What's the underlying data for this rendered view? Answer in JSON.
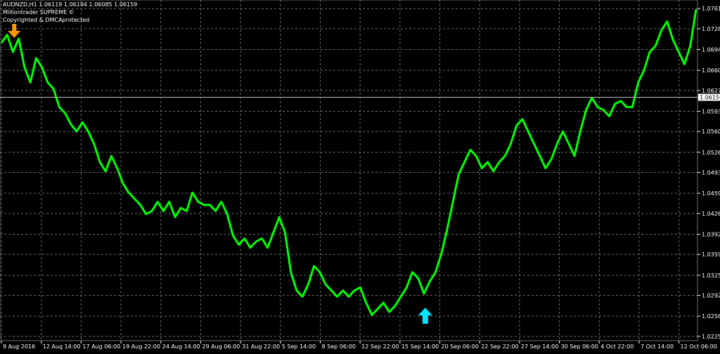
{
  "header": {
    "symbol_line": "AUDNZD,H1  1.06119 1.06194 1.06085 1.06159",
    "indicator_name": "Milliontrader SUPREME ©",
    "copyright": "Copyrighted & DMCAprotected"
  },
  "colors": {
    "background": "#000000",
    "price_line": "#00ff00",
    "grid": "#6e6e6e",
    "sell_arrow": "#ff9900",
    "buy_arrow": "#00e5ff",
    "axis_text": "#ffffff"
  },
  "chart_data": {
    "type": "line",
    "title": "AUDNZD,H1",
    "ylim": [
      1.0218,
      1.0775
    ],
    "current_price": "1.06159",
    "y_tick_labels": [
      "1.07610",
      "1.07280",
      "1.06940",
      "1.06600",
      "1.06270",
      "1.05930",
      "1.05600",
      "1.05260",
      "1.04930",
      "1.04590",
      "1.04260",
      "1.03920",
      "1.03590",
      "1.03250",
      "1.02920",
      "1.02580",
      "1.02250"
    ],
    "x_tick_labels": [
      "9 Aug 2016",
      "12 Aug 14:00",
      "17 Aug 06:00",
      "19 Aug 22:00",
      "24 Aug 14:00",
      "29 Aug 06:00",
      "31 Aug 22:00",
      "5 Sep 14:00",
      "8 Sep 06:00",
      "12 Sep 22:00",
      "15 Sep 14:00",
      "20 Sep 06:00",
      "22 Sep 22:00",
      "27 Sep 14:00",
      "30 Sep 06:00",
      "4 Oct 22:00",
      "7 Oct 14:00",
      "12 Oct 06:00"
    ],
    "series": [
      {
        "values": [
          1.0705,
          1.0718,
          1.069,
          1.0712,
          1.0665,
          1.064,
          1.068,
          1.0665,
          1.064,
          1.063,
          1.06,
          1.059,
          1.0572,
          1.056,
          1.0575,
          1.056,
          1.054,
          1.051,
          1.0495,
          1.052,
          1.05,
          1.0475,
          1.046,
          1.045,
          1.044,
          1.0425,
          1.043,
          1.0445,
          1.043,
          1.0445,
          1.042,
          1.0435,
          1.043,
          1.046,
          1.0445,
          1.044,
          1.044,
          1.043,
          1.0445,
          1.0425,
          1.039,
          1.0375,
          1.0385,
          1.037,
          1.038,
          1.0385,
          1.037,
          1.0395,
          1.042,
          1.0395,
          1.033,
          1.03,
          1.029,
          1.031,
          1.034,
          1.033,
          1.031,
          1.03,
          1.029,
          1.03,
          1.029,
          1.03,
          1.0305,
          1.028,
          1.026,
          1.027,
          1.028,
          1.0265,
          1.0275,
          1.029,
          1.0305,
          1.033,
          1.032,
          1.0295,
          1.0315,
          1.033,
          1.036,
          1.04,
          1.0445,
          1.049,
          1.051,
          1.053,
          1.052,
          1.05,
          1.051,
          1.0495,
          1.051,
          1.052,
          1.054,
          1.057,
          1.058,
          1.056,
          1.054,
          1.052,
          1.05,
          1.0515,
          1.054,
          1.056,
          1.054,
          1.052,
          1.056,
          1.0595,
          1.0615,
          1.06,
          1.0595,
          1.0585,
          1.0605,
          1.061,
          1.06,
          1.06,
          1.064,
          1.066,
          1.069,
          1.07,
          1.0725,
          1.074,
          1.071,
          1.069,
          1.067,
          1.07,
          1.076
        ]
      }
    ],
    "signals": [
      {
        "type": "sell",
        "x_index": 1
      },
      {
        "type": "buy",
        "x_index": 72
      }
    ]
  }
}
